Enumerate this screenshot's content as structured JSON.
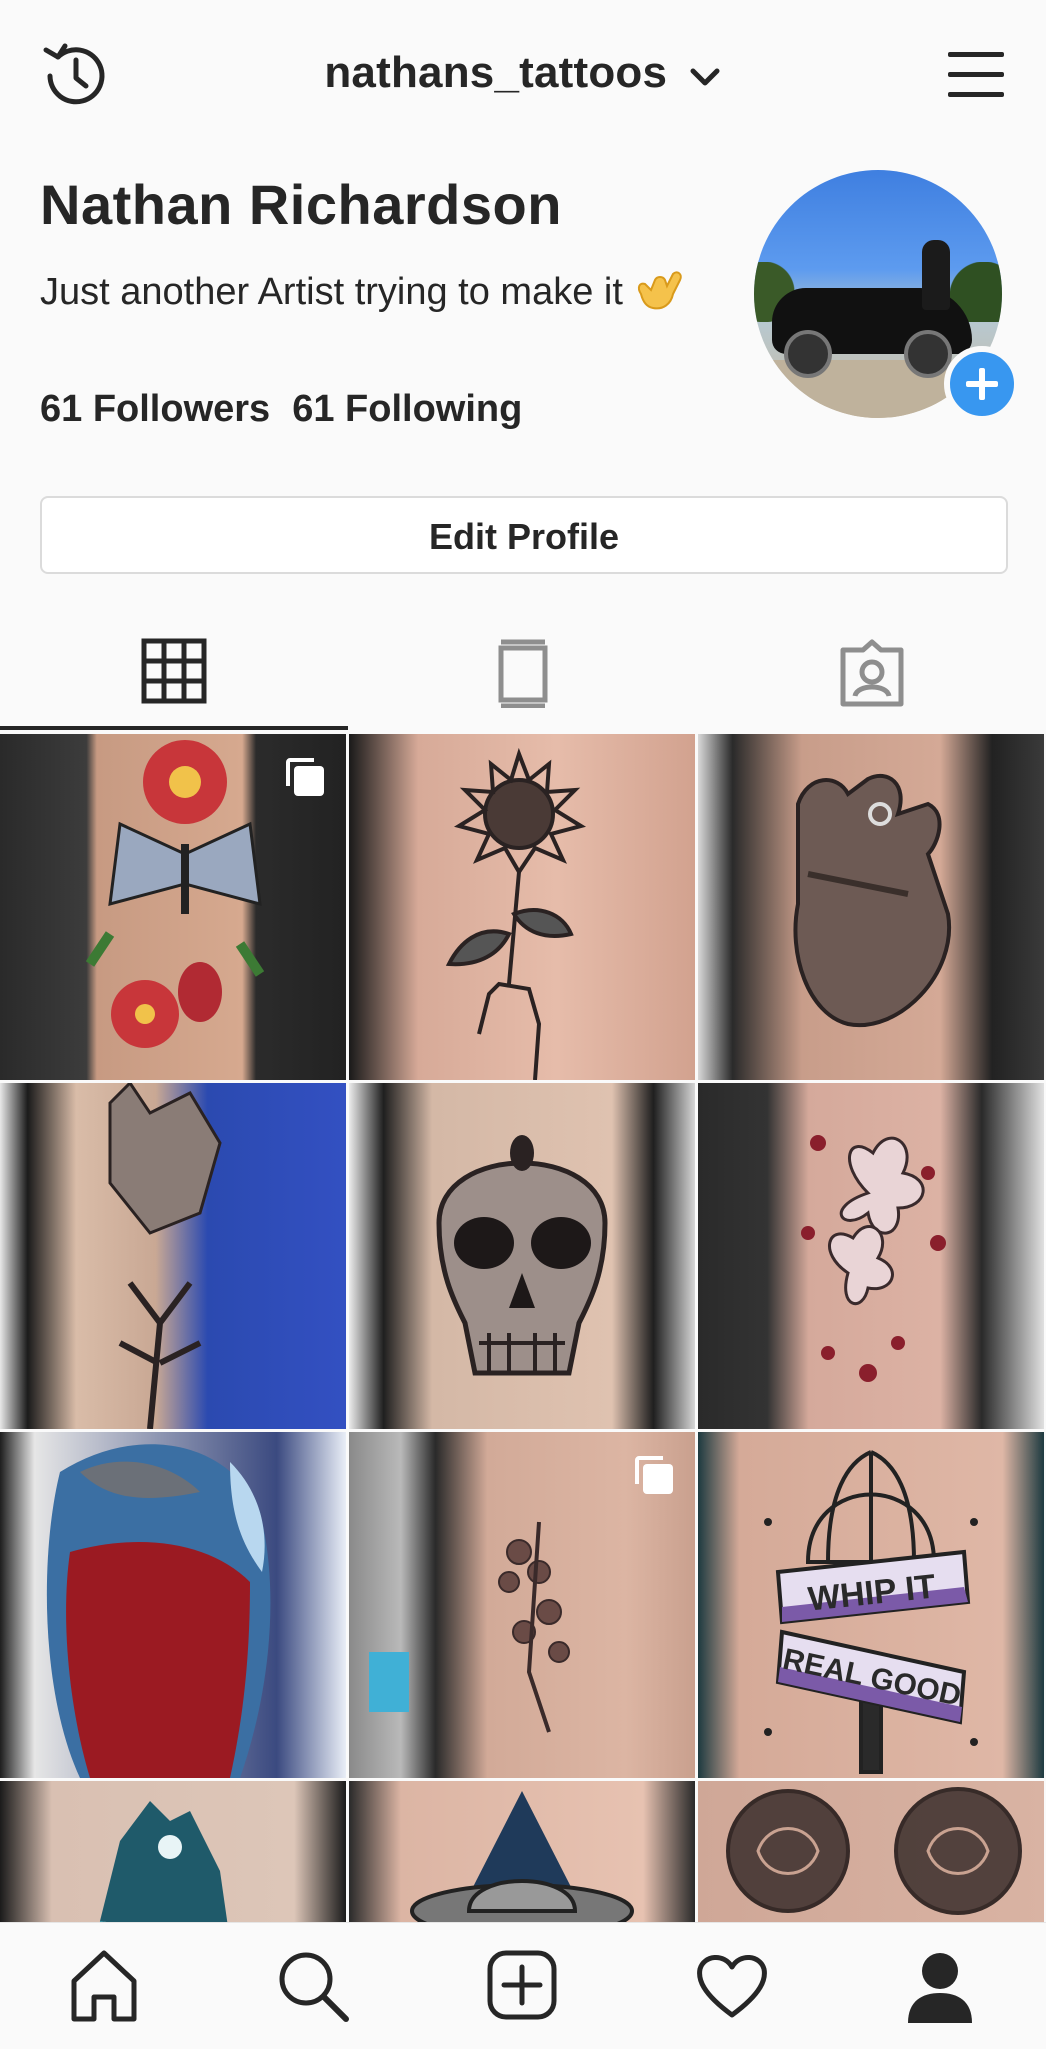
{
  "header": {
    "username": "nathans_tattoos",
    "icons": [
      "history-icon",
      "chevron-down-icon",
      "hamburger-menu-icon"
    ]
  },
  "profile": {
    "name": "Nathan Richardson",
    "bio": "Just another Artist trying to make it",
    "bio_emoji": "call-me-hand-emoji",
    "followers": "61 Followers",
    "following": "61 Following"
  },
  "edit_profile_label": "Edit Profile",
  "tabs": [
    {
      "name": "grid",
      "icon": "grid-icon",
      "active": true
    },
    {
      "name": "igtv",
      "icon": "igtv-icon",
      "active": false
    },
    {
      "name": "tagged",
      "icon": "tagged-icon",
      "active": false
    }
  ],
  "posts": [
    {
      "id": "butterfly-rose-sleeve",
      "multi": true
    },
    {
      "id": "sunflower-hand",
      "multi": false
    },
    {
      "id": "hand-with-ring",
      "multi": false
    },
    {
      "id": "wolf-tree-sleeve",
      "multi": false
    },
    {
      "id": "skull",
      "multi": false
    },
    {
      "id": "cherry-blossom-flowers",
      "multi": false
    },
    {
      "id": "color-galaxy-sleeve",
      "multi": false
    },
    {
      "id": "rib-flowers",
      "multi": true
    },
    {
      "id": "whip-it-real-good",
      "multi": false
    },
    {
      "id": "howling-wolf-moon",
      "multi": false
    },
    {
      "id": "ufo",
      "multi": false
    },
    {
      "id": "dotwork-roses",
      "multi": false
    }
  ],
  "post_text": {
    "whip_banner_top": "WHIP IT",
    "whip_banner_bottom": "REAL GOOD"
  },
  "bottom_nav": [
    "home-icon",
    "search-icon",
    "new-post-icon",
    "activity-heart-icon",
    "profile-icon"
  ],
  "colors": {
    "accent": "#3897f0",
    "text": "#262626",
    "border": "#dbdbdb",
    "background": "#fafafa"
  }
}
